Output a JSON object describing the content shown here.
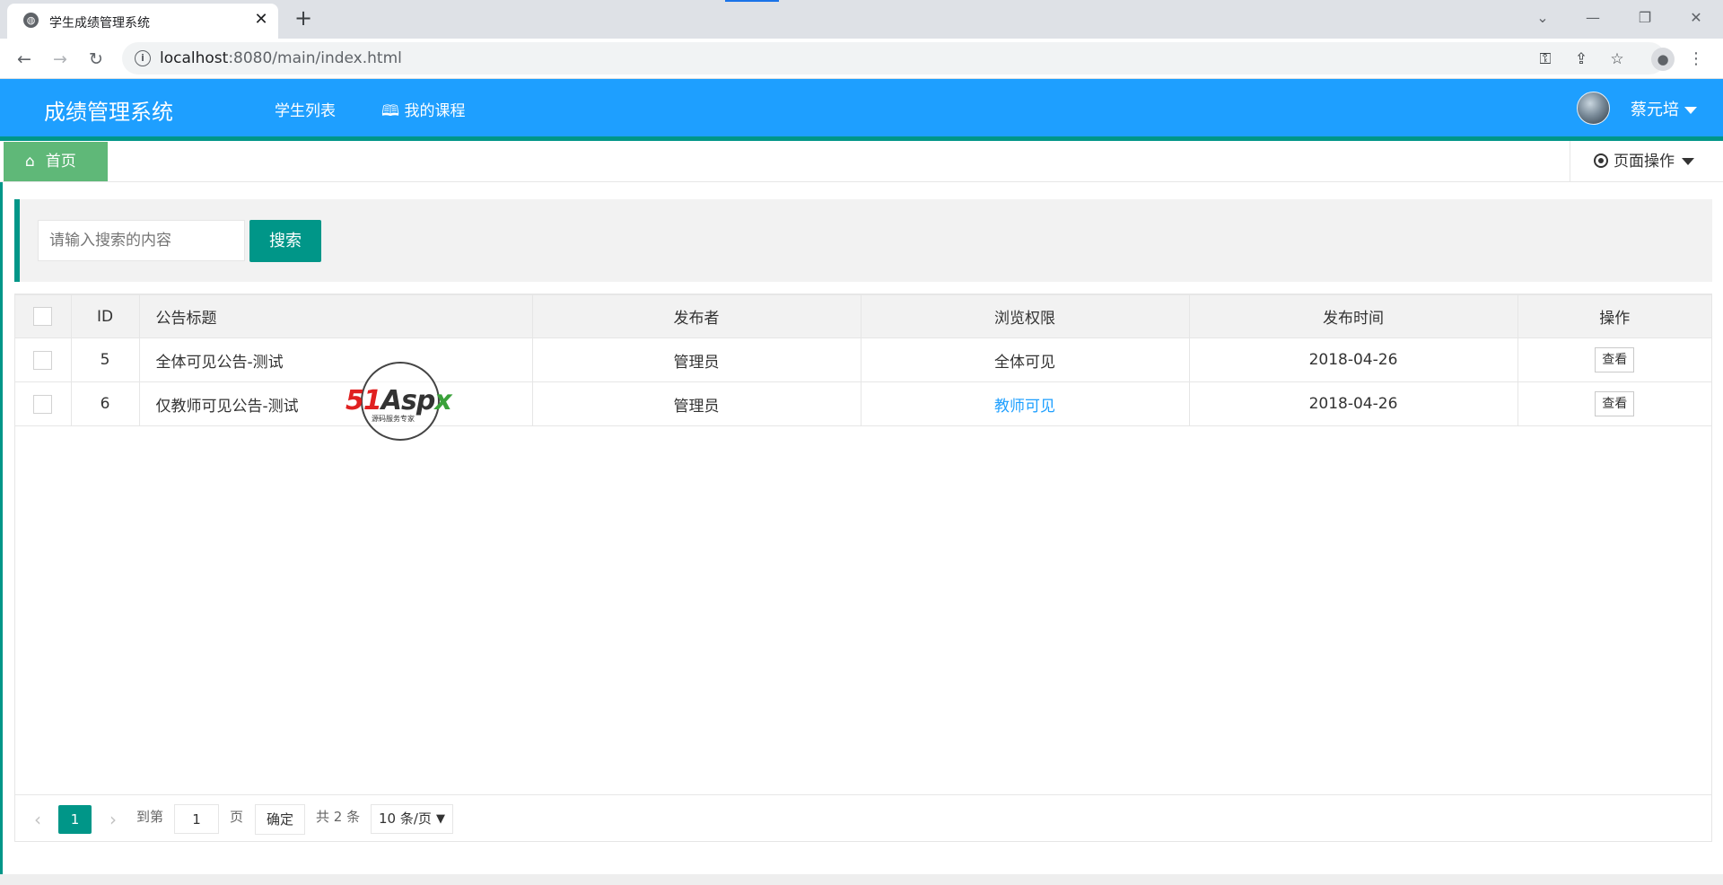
{
  "browser": {
    "tab_title": "学生成绩管理系统",
    "url_host": "localhost",
    "url_path": ":8080/main/index.html",
    "icons": [
      "globe-icon",
      "close-icon",
      "plus-icon",
      "back-icon",
      "forward-icon",
      "reload-icon",
      "info-icon",
      "key-icon",
      "share-icon",
      "star-icon",
      "profile-icon",
      "menu-icon",
      "minimize-icon",
      "restore-icon",
      "close-window-icon",
      "tab-search-icon"
    ]
  },
  "header": {
    "app_title": "成绩管理系统",
    "nav": [
      {
        "label": "学生列表"
      },
      {
        "label": "我的课程",
        "icon": "book-icon"
      }
    ],
    "user_name": "蔡元培",
    "colors": {
      "header_bg": "#1e9fff",
      "accent": "#009688",
      "home_tab": "#5fb878"
    }
  },
  "tabs": {
    "home_label": "首页",
    "page_ops_label": "页面操作"
  },
  "search": {
    "placeholder": "请输入搜索的内容",
    "button_label": "搜索"
  },
  "table": {
    "columns": [
      "ID",
      "公告标题",
      "发布者",
      "浏览权限",
      "发布时间",
      "操作"
    ],
    "rows": [
      {
        "id": "5",
        "title": "全体可见公告-测试",
        "publisher": "管理员",
        "permission": "全体可见",
        "date": "2018-04-26",
        "action": "查看"
      },
      {
        "id": "6",
        "title": "仅教师可见公告-测试",
        "publisher": "管理员",
        "permission": "教师可见",
        "date": "2018-04-26",
        "action": "查看"
      }
    ]
  },
  "watermark": {
    "brand_red": "51",
    "brand_dark": "Asp",
    "brand_green": "x",
    "tagline": "源码服务专家"
  },
  "pager": {
    "current_page": "1",
    "goto_prefix": "到第",
    "goto_value": "1",
    "goto_suffix": "页",
    "confirm_label": "确定",
    "total_label": "共 2 条",
    "page_size": "10 条/页"
  }
}
